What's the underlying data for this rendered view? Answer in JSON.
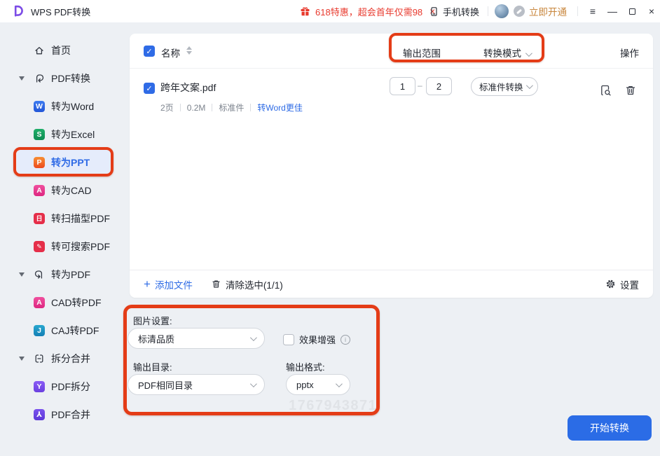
{
  "window": {
    "title": "WPS PDF转换",
    "controls": {
      "menu": "≡",
      "minimize": "—",
      "close": "×"
    }
  },
  "topbar": {
    "promo": {
      "text": "618特惠，超会首年仅需98",
      "close": "×"
    },
    "phone_label": "手机转换",
    "upgrade_label": "立即开通"
  },
  "sidebar": {
    "items": [
      {
        "label": "首页"
      },
      {
        "label": "PDF转换"
      },
      {
        "label": "转为Word",
        "badge": "W"
      },
      {
        "label": "转为Excel",
        "badge": "S"
      },
      {
        "label": "转为PPT",
        "badge": "P",
        "selected": true
      },
      {
        "label": "转为CAD",
        "badge": "A"
      },
      {
        "label": "转扫描型PDF",
        "badge": "日"
      },
      {
        "label": "转可搜索PDF",
        "badge": "✎"
      },
      {
        "label": "转为PDF"
      },
      {
        "label": "CAD转PDF",
        "badge": "A"
      },
      {
        "label": "CAJ转PDF",
        "badge": "J"
      },
      {
        "label": "拆分合并"
      },
      {
        "label": "PDF拆分",
        "badge": "Y"
      },
      {
        "label": "PDF合并",
        "badge": "⅄"
      }
    ]
  },
  "list": {
    "header": {
      "name_col": "名称",
      "range_col": "输出范围",
      "mode_col": "转换模式",
      "actions_col": "操作"
    },
    "file": {
      "name": "跨年文案.pdf",
      "pages": "2页",
      "size": "0.2M",
      "type": "标准件",
      "suggestion": "转Word更佳",
      "range_from": "1",
      "range_to": "2",
      "range_separator": "–",
      "mode": "标准件转换"
    },
    "toolbar": {
      "add": "添加文件",
      "clear": "清除选中(1/1)",
      "settings": "设置"
    }
  },
  "settings": {
    "image_label": "图片设置:",
    "quality": "标清品质",
    "enhance_label": "效果增强",
    "output_dir_label": "输出目录:",
    "output_dir": "PDF相同目录",
    "format_label": "输出格式:",
    "format": "pptx",
    "watermark": "1767943871"
  },
  "start_button": {
    "label": "开始转换"
  },
  "icons": {
    "check": "✓",
    "plus": "+",
    "info": "i"
  },
  "colors": {
    "accent_blue": "#2f6be6",
    "promo_red": "#e8392d",
    "upgrade_gold": "#c8863c",
    "annotation_red": "#e43c17",
    "button_blue": "#2b6ce6",
    "selected_item_bg": "#e5ecfb"
  }
}
